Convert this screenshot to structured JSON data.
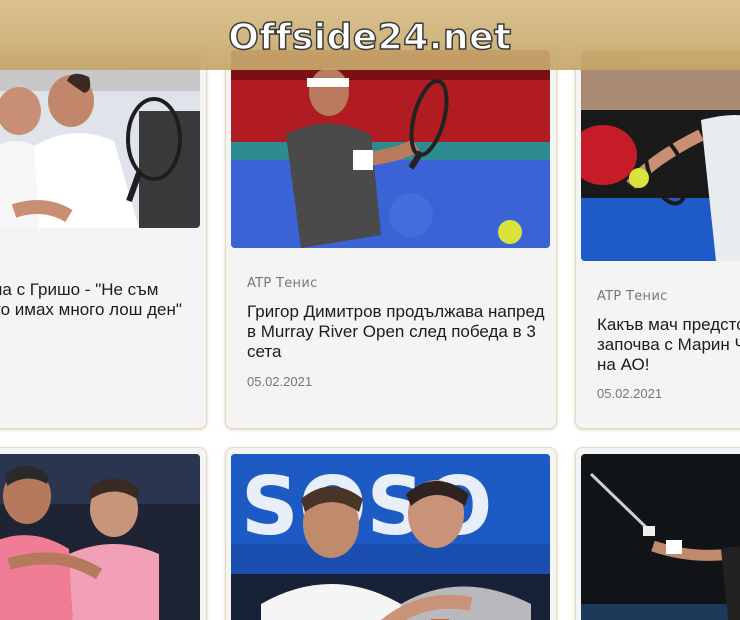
{
  "site": {
    "logo_text": "Offside24.net"
  },
  "articles": [
    {
      "title": "на с Гришо - \"Не съм\nто имах много лош ден\""
    },
    {
      "category": "ATP Тенис",
      "title": "Григор Димитров продължава напред\nв Murray River Open след победа в 3\nсета",
      "date": "05.02.2021"
    },
    {
      "category": "ATP Тенис",
      "title": "Какъв мач предстои\nзапочва с Марин Чи\nна АО!",
      "date": "05.02.2021"
    }
  ],
  "images": [
    {
      "icon": "tennis-players-photo"
    },
    {
      "icon": "grigor-dimitrov-forehand-photo"
    },
    {
      "icon": "tennis-forehand-photo"
    },
    {
      "icon": "kyrgios-dimitrov-photo"
    },
    {
      "icon": "nadal-dimitrov-photo"
    },
    {
      "icon": "tennis-player-night-photo"
    }
  ]
}
